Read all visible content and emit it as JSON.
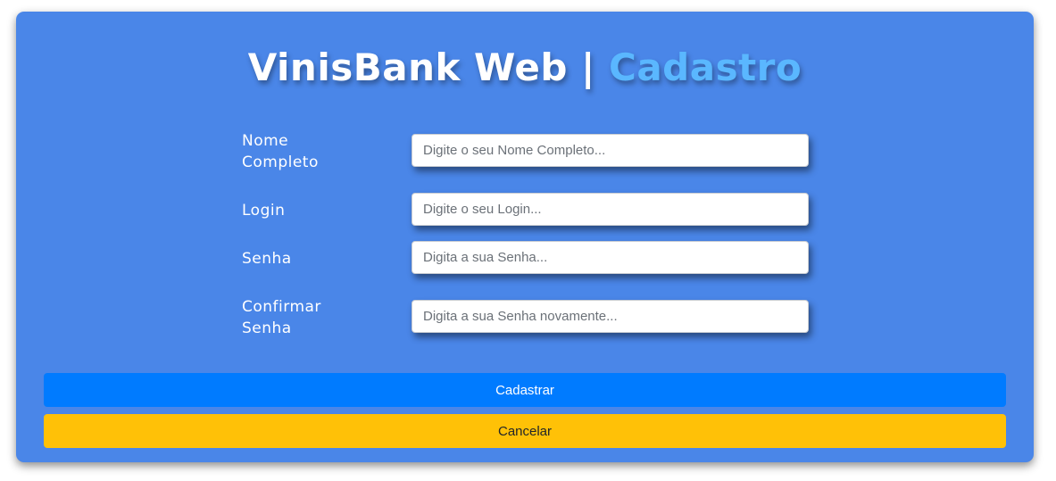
{
  "header": {
    "title_part1": "VinisBank Web",
    "title_separator": "|",
    "title_part2": "Cadastro"
  },
  "form": {
    "fields": [
      {
        "label_line1": "Nome",
        "label_line2": "Completo",
        "placeholder": "Digite o seu Nome Completo...",
        "value": ""
      },
      {
        "label_line1": "Login",
        "label_line2": "",
        "placeholder": "Digite o seu Login...",
        "value": ""
      },
      {
        "label_line1": "Senha",
        "label_line2": "",
        "placeholder": "Digita a sua Senha...",
        "value": ""
      },
      {
        "label_line1": "Confirmar",
        "label_line2": "Senha",
        "placeholder": "Digita a sua Senha novamente...",
        "value": ""
      }
    ]
  },
  "buttons": {
    "submit_label": "Cadastrar",
    "cancel_label": "Cancelar"
  },
  "colors": {
    "card_background": "#4a86e8",
    "title_accent": "#5ab7ff",
    "primary_button": "#007bff",
    "warning_button": "#ffc107"
  }
}
